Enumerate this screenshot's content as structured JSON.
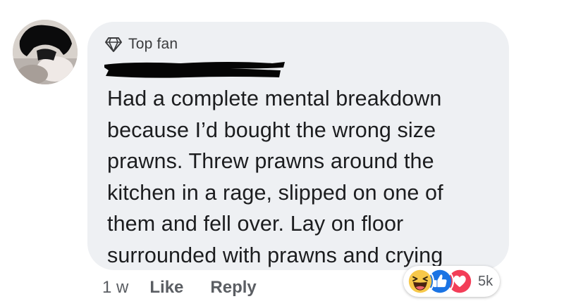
{
  "comment": {
    "badge_label": "Top fan",
    "badge_icon": "diamond-icon",
    "text": "Had a complete mental breakdown\nbecause I’d bought the wrong size\nprawns. Threw prawns around the\nkitchen in a rage, slipped on one of\nthem and fell over. Lay on floor\nsurrounded with prawns and crying"
  },
  "actions": {
    "time": "1 w",
    "like_label": "Like",
    "reply_label": "Reply"
  },
  "reactions": {
    "icons": [
      "haha-reaction-icon",
      "like-reaction-icon",
      "love-reaction-icon"
    ],
    "count": "5k"
  },
  "colors": {
    "bubble": "#eef0f3",
    "text": "#1c1d1f",
    "meta": "#5b5e63",
    "like_blue": "#1b74e4",
    "love_red": "#f33e58",
    "haha_yellow": "#f7c84a"
  }
}
